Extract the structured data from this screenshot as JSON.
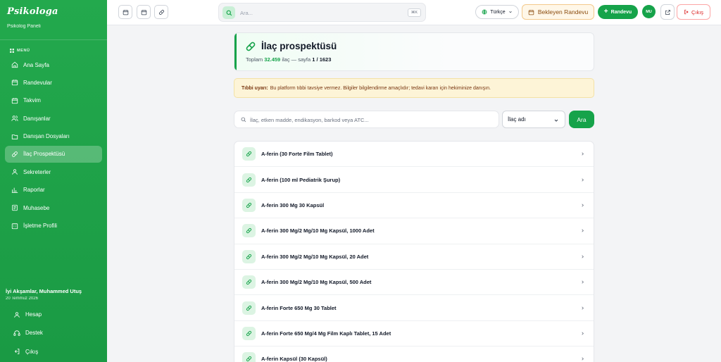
{
  "sidebar": {
    "brand": "Psikologa",
    "brand_sub": "Psikolog Paneli",
    "menu_title": "MENÜ",
    "items": [
      {
        "label": "Ana Sayfa",
        "icon": "home-icon"
      },
      {
        "label": "Randevular",
        "icon": "calendar-icon"
      },
      {
        "label": "Takvim",
        "icon": "calendar-icon"
      },
      {
        "label": "Danışanlar",
        "icon": "users-icon"
      },
      {
        "label": "Danışan Dosyaları",
        "icon": "folder-icon"
      },
      {
        "label": "İlaç Prospektüsü",
        "icon": "pill-icon",
        "active": true
      },
      {
        "label": "Sekreterler",
        "icon": "user-icon"
      },
      {
        "label": "Raporlar",
        "icon": "chart-icon"
      },
      {
        "label": "Muhasebe",
        "icon": "ledger-icon"
      },
      {
        "label": "İşletme Profili",
        "icon": "building-icon"
      }
    ],
    "greeting": "İyi Akşamlar, Muhammed Utuş",
    "date": "20 Temmuz 2026",
    "bottom": [
      {
        "label": "Hesap",
        "icon": "user-icon"
      },
      {
        "label": "Destek",
        "icon": "headset-icon"
      },
      {
        "label": "Çıkış",
        "icon": "logout-icon"
      }
    ]
  },
  "topbar": {
    "search_placeholder": "Ara...",
    "shortcut": "⌘K",
    "language": "Türkçe",
    "pending_label": "Bekleyen Randevu",
    "add_label": "Randevu",
    "avatar_initials": "MU",
    "logout_label": "Çıkış"
  },
  "page": {
    "title": "İlaç prospektüsü",
    "total_prefix": "Toplam",
    "total_count": "32.459",
    "total_unit": "ilaç — sayfa",
    "page_info": "1 / 1623",
    "warning_label": "Tıbbi uyarı:",
    "warning_text": "Bu platform tıbbi tavsiye vermez. Bilgiler bilgilendirme amaçlıdır; tedavi kararı için hekiminize danışın.",
    "search_placeholder": "İlaç, etken madde, endikasyon, barkod veya ATC...",
    "filter_value": "İlaç adı",
    "search_button": "Ara"
  },
  "drugs": [
    "A-ferin (30 Forte Film Tablet)",
    "A-ferin (100 ml Pediatrik Şurup)",
    "A-ferin 300 Mg 30 Kapsül",
    "A-ferin 300 Mg/2 Mg/10 Mg Kapsül, 1000 Adet",
    "A-ferin 300 Mg/2 Mg/10 Mg Kapsül, 20 Adet",
    "A-ferin 300 Mg/2 Mg/10 Mg Kapsül, 500 Adet",
    "A-ferin Forte 650 Mg 30 Tablet",
    "A-ferin Forte 650 Mg/4 Mg Film Kaplı Tablet, 15 Adet",
    "A-ferin Kapsül (30 Kapsül)"
  ],
  "colors": {
    "accent": "#16a34a",
    "sidebar": "#1fa24a",
    "warning_bg": "#fdf4d7"
  }
}
